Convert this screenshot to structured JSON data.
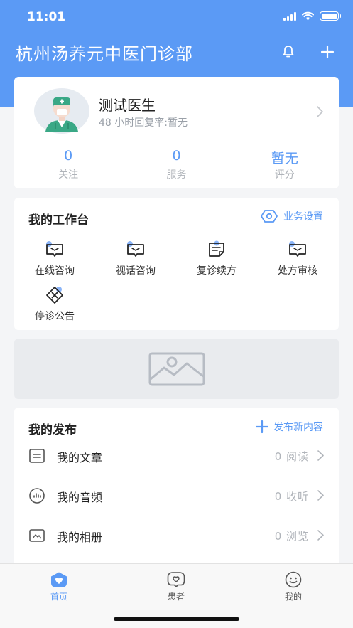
{
  "status_bar": {
    "time": "11:01"
  },
  "header": {
    "title": "杭州汤养元中医门诊部",
    "bell_icon": "bell-icon",
    "add_icon": "plus-icon"
  },
  "profile": {
    "name": "测试医生",
    "reply_rate": "48 小时回复率:暂无",
    "stats": [
      {
        "value": "0",
        "label": "关注"
      },
      {
        "value": "0",
        "label": "服务"
      },
      {
        "value": "暂无",
        "label": "评分"
      }
    ]
  },
  "workbench": {
    "title": "我的工作台",
    "settings_label": "业务设置",
    "tools": [
      {
        "label": "在线咨询",
        "icon": "chat-icon"
      },
      {
        "label": "视话咨询",
        "icon": "video-chat-icon"
      },
      {
        "label": "复诊续方",
        "icon": "prescription-renew-icon"
      },
      {
        "label": "处方审核",
        "icon": "prescription-review-icon"
      },
      {
        "label": "停诊公告",
        "icon": "suspend-notice-icon"
      }
    ]
  },
  "banner": {
    "icon": "image-placeholder-icon"
  },
  "publish": {
    "title": "我的发布",
    "new_label": "发布新内容",
    "rows": [
      {
        "label": "我的文章",
        "count": "0 阅读",
        "icon": "article-icon"
      },
      {
        "label": "我的音频",
        "count": "0 收听",
        "icon": "audio-icon"
      },
      {
        "label": "我的相册",
        "count": "0 浏览",
        "icon": "album-icon"
      }
    ]
  },
  "tabbar": {
    "active_color": "#5b9af5",
    "inactive_color": "#555555",
    "tabs": [
      {
        "label": "首页",
        "icon": "home-icon"
      },
      {
        "label": "患者",
        "icon": "patients-icon"
      },
      {
        "label": "我的",
        "icon": "profile-icon"
      }
    ]
  },
  "colors": {
    "primary": "#5b9af5",
    "background": "#f4f5f7"
  }
}
